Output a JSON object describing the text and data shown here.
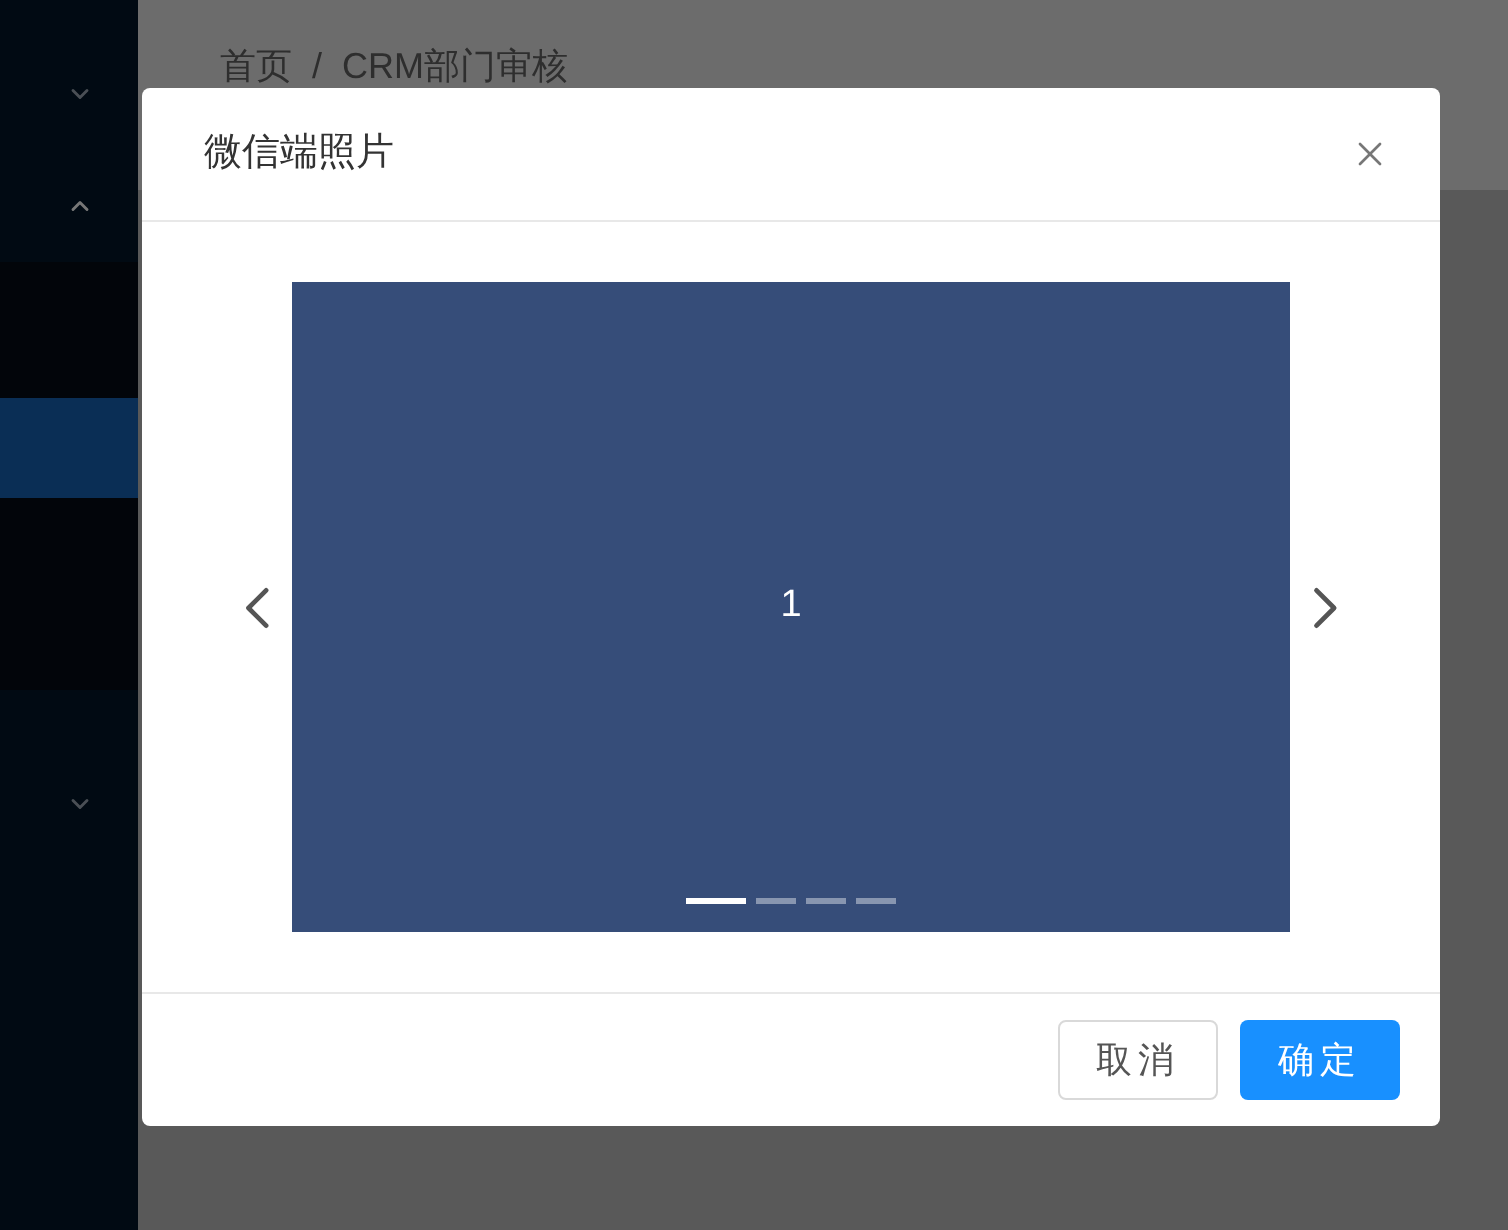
{
  "sidebar": {
    "menus": [
      {
        "expanded": false
      },
      {
        "expanded": true,
        "children": [
          {
            "selected": false
          },
          {
            "selected": true
          },
          {
            "selected": false
          }
        ]
      },
      {
        "expanded": false
      }
    ]
  },
  "breadcrumb": {
    "items": [
      "首页",
      "CRM部门审核"
    ],
    "separator": "/"
  },
  "modal": {
    "title": "微信端照片",
    "carousel": {
      "slide_label": "1",
      "dots": [
        {
          "selected": true
        },
        {
          "selected": false
        },
        {
          "selected": false
        },
        {
          "selected": false
        }
      ]
    },
    "buttons": [
      {
        "label": "取消",
        "kind": "default"
      },
      {
        "label": "确定",
        "kind": "primary"
      }
    ]
  }
}
